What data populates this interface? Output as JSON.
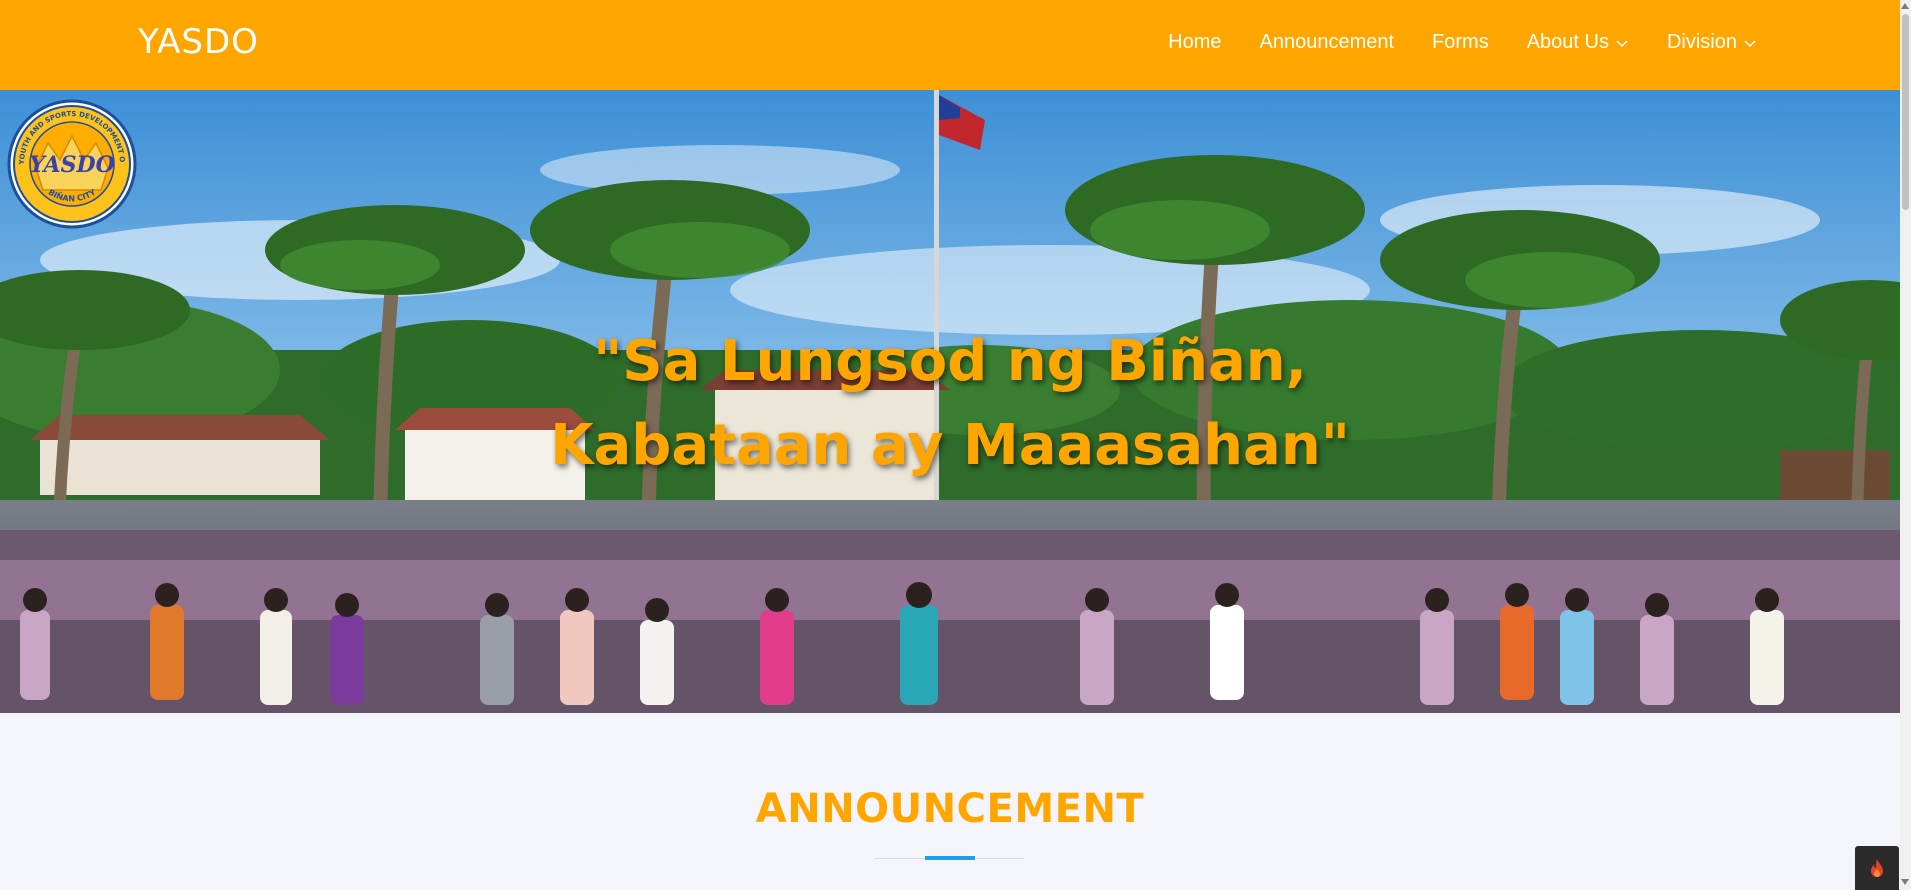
{
  "header": {
    "brand": "YASDO",
    "nav": [
      {
        "label": "Home",
        "has_dropdown": false
      },
      {
        "label": "Announcement",
        "has_dropdown": false
      },
      {
        "label": "Forms",
        "has_dropdown": false
      },
      {
        "label": "About Us",
        "has_dropdown": true
      },
      {
        "label": "Division",
        "has_dropdown": true
      }
    ]
  },
  "seal": {
    "center_text": "YASDO",
    "ring_top": "CITY YOUTH AND SPORTS DEVELOPMENT OFFICE",
    "ring_bottom": "BIÑAN CITY"
  },
  "hero": {
    "line1": "\"Sa Lungsod ng Biñan,",
    "line2": "Kabataan ay Maaasahan\""
  },
  "announcement": {
    "title": "ANNOUNCEMENT"
  },
  "colors": {
    "accent": "#ffa500",
    "divider_accent": "#1ea0e6",
    "section_bg": "#f3f5fa"
  },
  "icons": {
    "dropdown": "chevron-down-icon",
    "badge": "fire-icon"
  }
}
